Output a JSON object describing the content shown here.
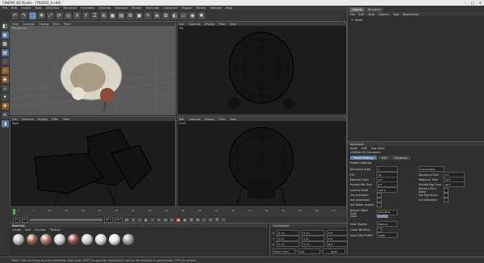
{
  "window": {
    "title": "CINEMA 4D Studio - [TR0202_A.c4d]",
    "controls": [
      "–",
      "□",
      "✕"
    ]
  },
  "menu": [
    "File",
    "Edit",
    "Create",
    "Tools",
    "Selection",
    "Structure",
    "Functions",
    "Animate",
    "Simulate",
    "Render",
    "MoGraph",
    "Character",
    "Plugins",
    "Python",
    "Window",
    "Help"
  ],
  "viewports": [
    {
      "label": "Perspective",
      "menu": [
        "View",
        "Cameras",
        "Display",
        "Filter",
        "Panel"
      ]
    },
    {
      "label": "Top",
      "menu": [
        "Edit",
        "Cameras",
        "Display",
        "Filter",
        "View"
      ]
    },
    {
      "label": "Right",
      "menu": [
        "Edit",
        "Cameras",
        "Display",
        "Filter",
        "View"
      ]
    },
    {
      "label": "Front",
      "menu": [
        "Edit",
        "Cameras",
        "Display",
        "Filter",
        "View"
      ]
    }
  ],
  "timeline": {
    "ticks": [
      "0",
      "5",
      "10",
      "15",
      "20",
      "25",
      "30",
      "35",
      "40",
      "45",
      "50",
      "55",
      "60",
      "65",
      "70",
      "75",
      "80",
      "85",
      "90",
      "0 F"
    ],
    "start": "0 F",
    "min": "0 F",
    "max": "90 F",
    "end": "90 F"
  },
  "materials": {
    "menu": [
      "Create",
      "Edit",
      "Function",
      "Texture"
    ],
    "tab": "Materials",
    "swatches": [
      "#b9b9b9",
      "#8d5a45",
      "#a06a55",
      "#cfcfcf",
      "#8a4a3c",
      "#c9c9c9",
      "#d8d8d0",
      "#e4e4e4",
      "#9a9a9a"
    ]
  },
  "coordinates": {
    "title": "Coordinates",
    "rows": [
      {
        "axis": "X",
        "pos": "0 cm",
        "size": "0 cm",
        "rot": "H 0°"
      },
      {
        "axis": "Y",
        "pos": "0 cm",
        "size": "0 cm",
        "rot": "P 0°"
      },
      {
        "axis": "Z",
        "pos": "0 cm",
        "size": "0 cm",
        "rot": "B 0°"
      }
    ],
    "mode": "Object (Rel)",
    "size_mode": "Size",
    "apply": "Apply"
  },
  "objects": {
    "tabs": [
      "Objects",
      "Structure"
    ],
    "menu": [
      "File",
      "Edit",
      "View",
      "Objects",
      "Tags",
      "Bookmarks"
    ],
    "item": "Robot"
  },
  "attributes": {
    "title": "Attributes",
    "mode_menu": [
      "Mode",
      "Edit",
      "User Data"
    ],
    "doc_title": "CINEMA 4D Document",
    "subtabs": [
      "Project Settings",
      "Info",
      "Dynamics"
    ],
    "section": "Project Settings",
    "left_rows": [
      {
        "label": "Document Scale",
        "value": "1"
      },
      {
        "label": "FPS",
        "value": "30"
      },
      {
        "label": "Minimum Time",
        "value": "0 F"
      },
      {
        "label": "Preview Min Time",
        "value": "0 F"
      },
      {
        "label": "Level of Detail",
        "value": "100 %"
      },
      {
        "label": "Use Animation",
        "value": ""
      },
      {
        "label": "Use Generators",
        "value": ""
      },
      {
        "label": "Use Motion System",
        "value": ""
      },
      {
        "label": "Default Object Color",
        "value": "Gray-Blue"
      },
      {
        "label": "Color",
        "value": ""
      },
      {
        "label": "View Clipping",
        "value": "Medium"
      },
      {
        "label": "Linear Workflow",
        "value": ""
      },
      {
        "label": "Input Color Profile",
        "value": "sRGB"
      }
    ],
    "right_rows": [
      {
        "label": "Centimeters",
        "value": ""
      },
      {
        "label": "Document Time",
        "value": "0 F"
      },
      {
        "label": "Maximum Time",
        "value": "90 F"
      },
      {
        "label": "Preview Max Time",
        "value": "90 F"
      },
      {
        "label": "Render LOD in Editor",
        "value": ""
      },
      {
        "label": "Use Expression",
        "value": ""
      },
      {
        "label": "Use Deformers",
        "value": ""
      }
    ]
  },
  "status": "Move: Click and drag to move elements. Hold down SHIFT to quantize movement / add to the selection in point mode, CTRL to remove."
}
